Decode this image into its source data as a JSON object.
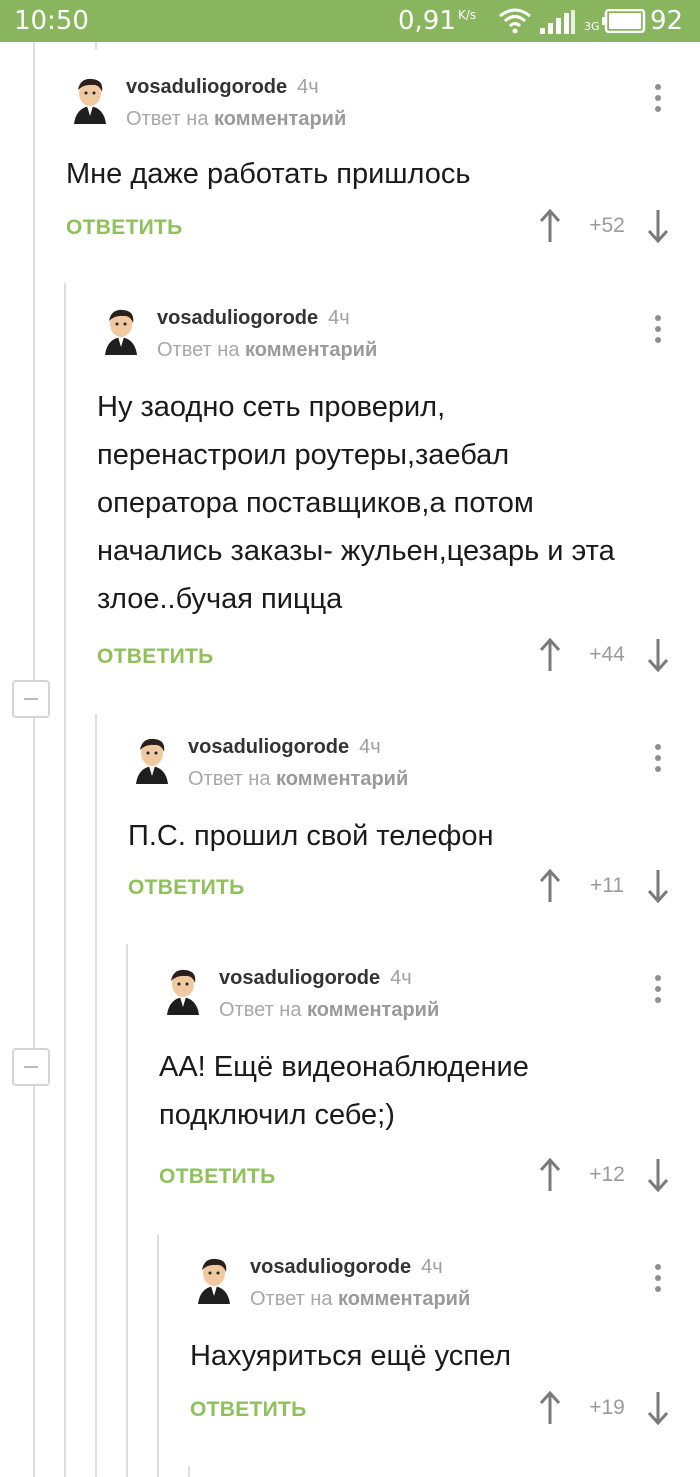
{
  "status_bar": {
    "time": "10:50",
    "speed": "0,91",
    "speed_unit": "K/s",
    "network": "3G",
    "battery": "92",
    "color": "#8ab55f"
  },
  "accent_color": "#8ec15a",
  "comments": [
    {
      "author": "vosaduliogorode",
      "time": "4ч",
      "reply_prefix": "Ответ на",
      "reply_target": "комментарий",
      "text_lines": [
        "Мне даже работать пришлось"
      ],
      "reply_label": "ОТВЕТИТЬ",
      "score": "+52"
    },
    {
      "author": "vosaduliogorode",
      "time": "4ч",
      "reply_prefix": "Ответ на",
      "reply_target": "комментарий",
      "text_lines": [
        "Ну заодно сеть проверил,",
        "перенастроил роутеры,заебал",
        "оператора поставщиков,а потом",
        "начались заказы- жульен,цезарь и эта",
        "злое..бучая пицца"
      ],
      "reply_label": "ОТВЕТИТЬ",
      "score": "+44"
    },
    {
      "author": "vosaduliogorode",
      "time": "4ч",
      "reply_prefix": "Ответ на",
      "reply_target": "комментарий",
      "text_lines": [
        "П.С. прошил свой телефон"
      ],
      "reply_label": "ОТВЕТИТЬ",
      "score": "+11"
    },
    {
      "author": "vosaduliogorode",
      "time": "4ч",
      "reply_prefix": "Ответ на",
      "reply_target": "комментарий",
      "text_lines": [
        "АА! Ещё видеонаблюдение",
        "подключил себе;)"
      ],
      "reply_label": "ОТВЕТИТЬ",
      "score": "+12"
    },
    {
      "author": "vosaduliogorode",
      "time": "4ч",
      "reply_prefix": "Ответ на",
      "reply_target": "комментарий",
      "text_lines": [
        "Нахуяриться ещё успел"
      ],
      "reply_label": "ОТВЕТИТЬ",
      "score": "+19"
    }
  ]
}
